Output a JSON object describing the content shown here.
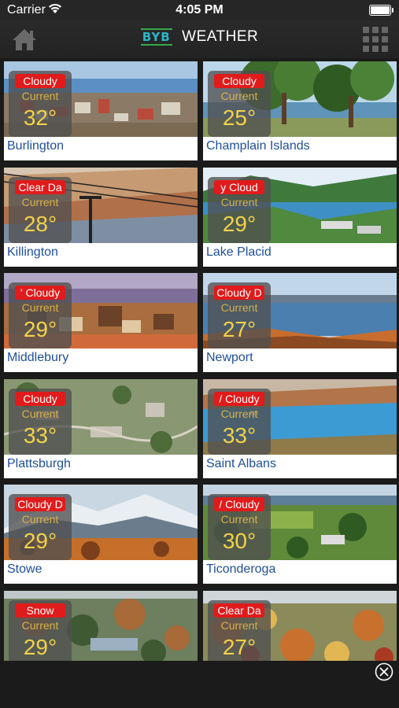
{
  "status_bar": {
    "carrier": "Carrier",
    "time": "4:05 PM"
  },
  "nav": {
    "logo": "BYB",
    "title": "WEATHER"
  },
  "current_label": "Current",
  "locations": [
    {
      "city": "Burlington",
      "condition": "Cloudy",
      "temp": "32°",
      "scene": "town-lake"
    },
    {
      "city": "Champlain Islands",
      "condition": "Cloudy",
      "temp": "25°",
      "scene": "trees-water"
    },
    {
      "city": "Killington",
      "condition": "Clear Da",
      "temp": "28°",
      "scene": "ski-lift"
    },
    {
      "city": "Lake Placid",
      "condition": "y Cloud",
      "temp": "29°",
      "scene": "lake-hills"
    },
    {
      "city": "Middlebury",
      "condition": "' Cloudy",
      "temp": "29°",
      "scene": "town-autumn"
    },
    {
      "city": "Newport",
      "condition": "Cloudy D",
      "temp": "27°",
      "scene": "lake-autumn"
    },
    {
      "city": "Plattsburgh",
      "condition": "Cloudy",
      "temp": "33°",
      "scene": "aerial-town"
    },
    {
      "city": "Saint Albans",
      "condition": "/ Cloudy",
      "temp": "33°",
      "scene": "bay-autumn"
    },
    {
      "city": "Stowe",
      "condition": "Cloudy D",
      "temp": "29°",
      "scene": "mountain-snow"
    },
    {
      "city": "Ticonderoga",
      "condition": "/ Cloudy",
      "temp": "30°",
      "scene": "green-fields"
    },
    {
      "city": "",
      "condition": "Snow",
      "temp": "29°",
      "scene": "forest-autumn"
    },
    {
      "city": "",
      "condition": "Clear Da",
      "temp": "27°",
      "scene": "autumn-valley"
    }
  ]
}
